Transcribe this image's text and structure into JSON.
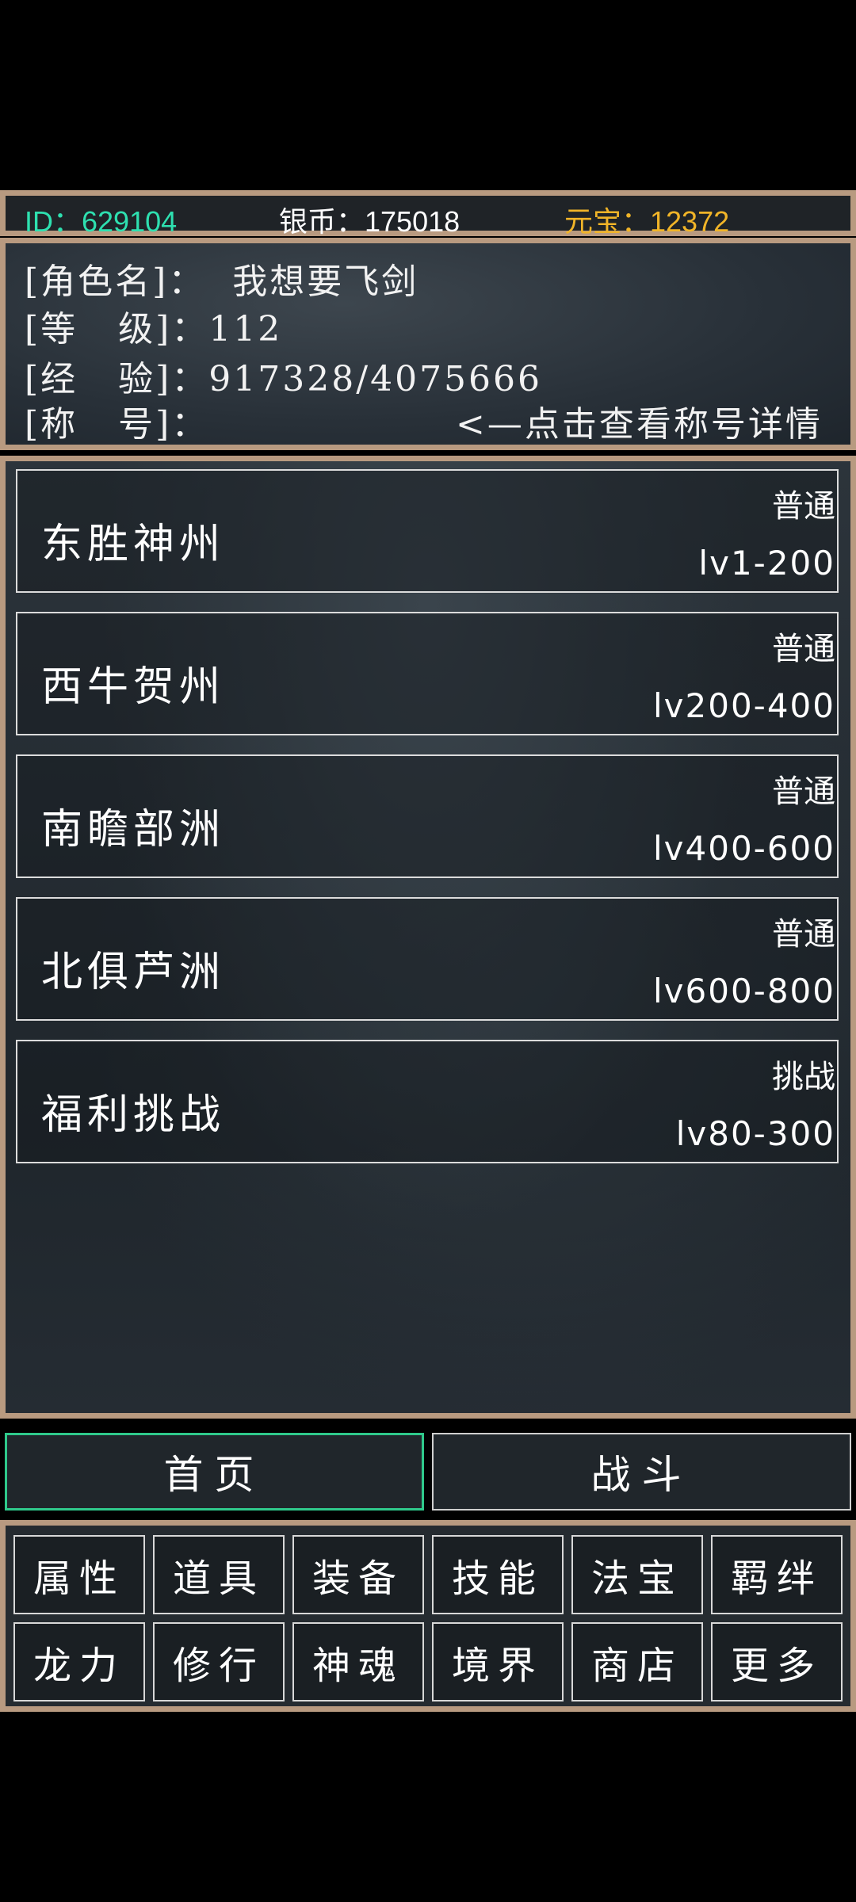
{
  "topbar": {
    "id_text": "ID：629104",
    "silver_text": "银币：175018",
    "ingot_text": "元宝：12372",
    "colors": {
      "id": "#2ee0b0",
      "silver": "#ffffff",
      "ingot": "#f0b428"
    }
  },
  "character": {
    "name_line": "[角色名]：  我想要飞剑",
    "level_line": "[等   级]：112",
    "exp_line": "[经   验]：917328/4075666",
    "title_label": "[称   号]：",
    "title_hint": "<—点击查看称号详情"
  },
  "maps": [
    {
      "name": "东胜神州",
      "type": "普通",
      "range": "lv1-200"
    },
    {
      "name": "西牛贺州",
      "type": "普通",
      "range": "lv200-400"
    },
    {
      "name": "南瞻部洲",
      "type": "普通",
      "range": "lv400-600"
    },
    {
      "name": "北俱芦洲",
      "type": "普通",
      "range": "lv600-800"
    },
    {
      "name": "福利挑战",
      "type": "挑战",
      "range": "lv80-300"
    }
  ],
  "tabs": {
    "home": "首页",
    "battle": "战斗"
  },
  "grid": [
    "属性",
    "道具",
    "装备",
    "技能",
    "法宝",
    "羁绊",
    "龙力",
    "修行",
    "神魂",
    "境界",
    "商店",
    "更多"
  ]
}
